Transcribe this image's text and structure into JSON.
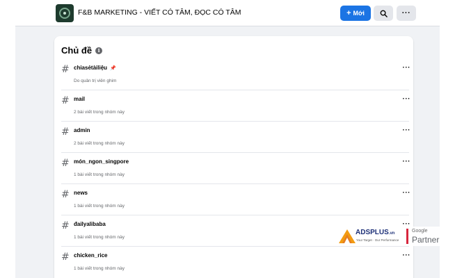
{
  "header": {
    "group_name": "F&B MARKETING - VIẾT CÓ TÂM, ĐỌC CÓ TÂM",
    "new_button_label": "Mới",
    "new_button_icon": "plus-icon",
    "search_icon": "search-icon",
    "more_icon": "more-icon",
    "accent_color": "#1b74e4"
  },
  "topics_card": {
    "title": "Chủ đề",
    "info_icon": "info-icon",
    "items": [
      {
        "name": "chiasẻtàiliệu",
        "subtitle": "Do quản trị viên ghim",
        "pinned": true
      },
      {
        "name": "mail",
        "subtitle": "2 bài viết trong nhóm này",
        "pinned": false
      },
      {
        "name": "admin",
        "subtitle": "2 bài viết trong nhóm này",
        "pinned": false
      },
      {
        "name": "món_ngon_singpore",
        "subtitle": "1 bài viết trong nhóm này",
        "pinned": false
      },
      {
        "name": "news",
        "subtitle": "1 bài viết trong nhóm này",
        "pinned": false
      },
      {
        "name": "đailyalibaba",
        "subtitle": "1 bài viết trong nhóm này",
        "pinned": false
      },
      {
        "name": "chicken_rice",
        "subtitle": "1 bài viết trong nhóm này",
        "pinned": false
      }
    ]
  },
  "watermark": {
    "brand": "ADSPLUS",
    "brand_suffix": ".vn",
    "tagline": "Your Target · Our Performance",
    "partner_top": "Google",
    "partner_bottom": "Partner"
  }
}
